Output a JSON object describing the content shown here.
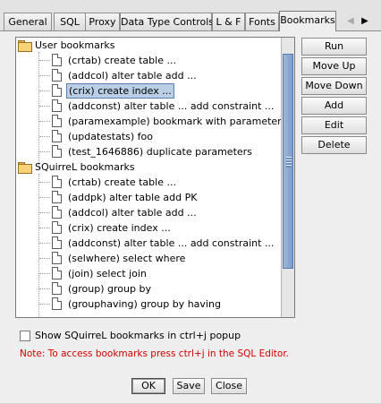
{
  "tabs": [
    {
      "label": "General",
      "selected": false
    },
    {
      "label": "SQL",
      "selected": false
    },
    {
      "label": "Proxy",
      "selected": false
    },
    {
      "label": "Data Type Controls",
      "selected": false
    },
    {
      "label": "L & F",
      "selected": false
    },
    {
      "label": "Fonts",
      "selected": false
    },
    {
      "label": "Bookmarks",
      "selected": true
    }
  ],
  "tab_nav": {
    "prev": "◀",
    "next": "▶"
  },
  "tree": {
    "user_folder": "User bookmarks",
    "user_items": [
      "(crtab)  create table ...",
      "(addcol)  alter table add ...",
      "(crix)  create index ...",
      "(addconst)  alter table ... add constraint ...",
      "(paramexample)  bookmark with parameters",
      "(updatestats)  foo",
      "(test_1646886)  duplicate parameters"
    ],
    "selected_item": "(crix)  create index ...",
    "squirrel_folder": "SQuirreL bookmarks",
    "squirrel_items": [
      "(crtab)  create table ...",
      "(addpk)  alter table add PK",
      "(addcol)  alter table add ...",
      "(crix)  create index ...",
      "(addconst)  alter table ... add constraint ...",
      "(selwhere)  select where",
      "(join)  select join",
      "(group)  group by",
      "(grouphaving)  group by having"
    ]
  },
  "buttons": {
    "run": "Run",
    "move_up": "Move Up",
    "move_down": "Move Down",
    "add": "Add",
    "edit": "Edit",
    "delete": "Delete"
  },
  "checkbox": {
    "label": "Show SQuirreL bookmarks in ctrl+j popup",
    "checked": false
  },
  "note": "Note: To access bookmarks press ctrl+j in the SQL Editor.",
  "dialog_buttons": {
    "ok": "OK",
    "save": "Save",
    "close": "Close"
  },
  "colors": {
    "note": "#d00000",
    "selection": "#b8cfe5",
    "scroll_thumb": "#7d9ccc"
  }
}
